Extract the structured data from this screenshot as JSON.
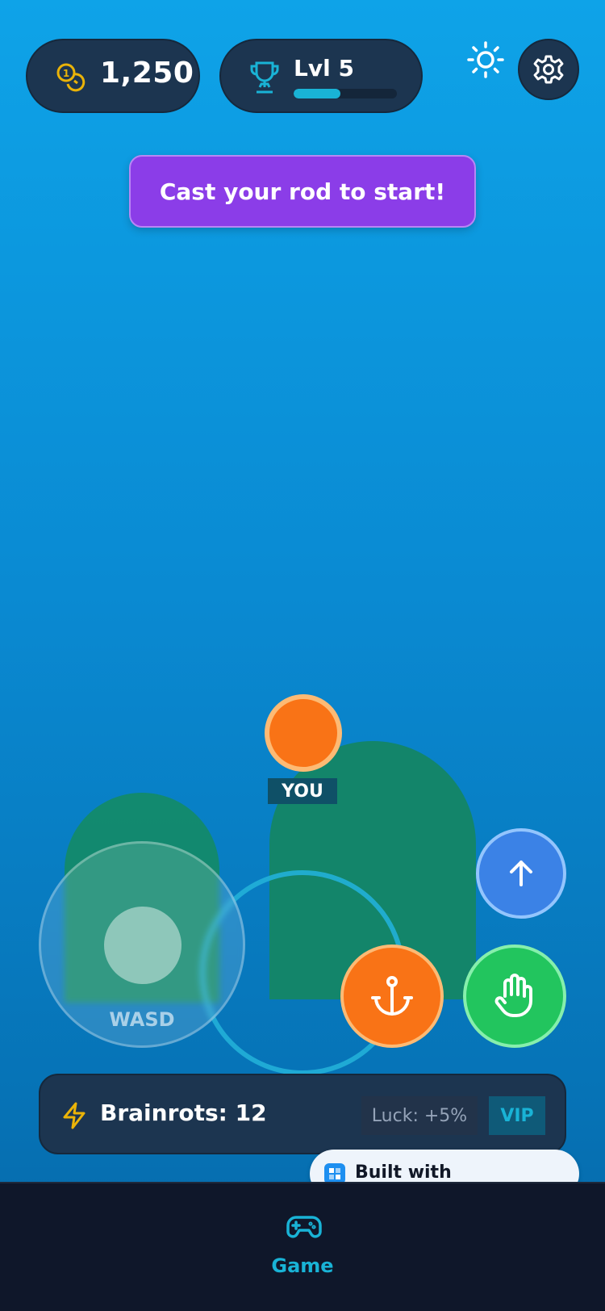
{
  "hud": {
    "coins": "1,250",
    "level_label": "Lvl 5",
    "level_progress": 0.45
  },
  "banner": {
    "text": "Cast your rod to start!"
  },
  "scene": {
    "player_label": "YOU"
  },
  "joystick": {
    "label": "WASD"
  },
  "actions": {
    "up_icon": "arrow-up-icon",
    "anchor_icon": "anchor-icon",
    "grab_icon": "hand-icon"
  },
  "status": {
    "brainrots": "Brainrots: 12",
    "luck": "Luck: +5%",
    "vip": "VIP"
  },
  "footer_badge": {
    "text": "Built with RapidNative"
  },
  "tabbar": {
    "tabs": [
      {
        "label": "Game",
        "icon": "gamepad-icon",
        "active": true
      }
    ]
  },
  "colors": {
    "accent": "#19b3d6",
    "orange": "#f97316",
    "green": "#22c55e",
    "blue": "#3b82e6",
    "purple": "#8b3de8",
    "panel": "#1c3550"
  }
}
